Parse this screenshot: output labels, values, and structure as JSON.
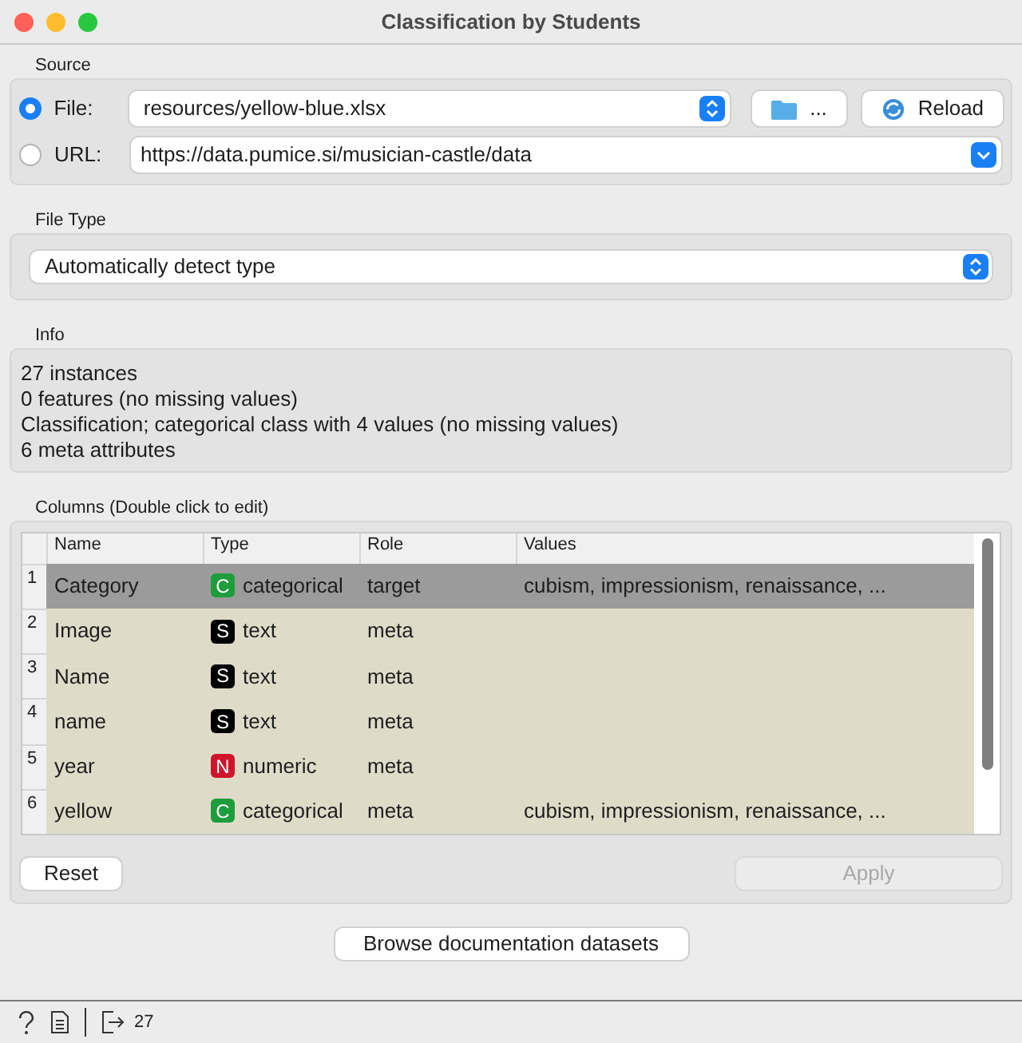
{
  "window": {
    "title": "Classification by Students"
  },
  "source": {
    "label": "Source",
    "options": [
      {
        "label": "File:",
        "selected": true,
        "value": "resources/yellow-blue.xlsx",
        "kind": "file"
      },
      {
        "label": "URL:",
        "selected": false,
        "value": "https://data.pumice.si/musician-castle/data",
        "kind": "url"
      }
    ],
    "browse_button": "...",
    "reload_button": "Reload"
  },
  "file_type": {
    "label": "File Type",
    "value": "Automatically detect type"
  },
  "info": {
    "label": "Info",
    "lines": [
      "27 instances",
      "0 features (no missing values)",
      "Classification; categorical class with 4 values (no missing values)",
      "6 meta attributes"
    ]
  },
  "columns": {
    "label": "Columns (Double click to edit)",
    "table": {
      "columns": [
        "Name",
        "Type",
        "Role",
        "Values"
      ],
      "rows": [
        {
          "index": "1",
          "name": "Category",
          "badge": "C",
          "kind": "categorical",
          "type": "categorical",
          "role": "target",
          "values": "cubism, impressionism, renaissance, ...",
          "selected": true
        },
        {
          "index": "2",
          "name": "Image",
          "badge": "S",
          "kind": "text",
          "type": "text",
          "role": "meta",
          "selected": false
        },
        {
          "index": "3",
          "name": "Name",
          "badge": "S",
          "kind": "text",
          "type": "text",
          "role": "meta",
          "selected": false
        },
        {
          "index": "4",
          "name": "name",
          "badge": "S",
          "kind": "text",
          "type": "text",
          "role": "meta",
          "selected": false
        },
        {
          "index": "5",
          "name": "year",
          "badge": "N",
          "kind": "numeric",
          "type": "numeric",
          "role": "meta",
          "selected": false
        },
        {
          "index": "6",
          "name": "yellow",
          "badge": "C",
          "kind": "categorical",
          "type": "categorical",
          "role": "meta",
          "values": "cubism, impressionism, renaissance, ...",
          "selected": false
        }
      ]
    },
    "reset_button": "Reset",
    "apply_button": {
      "label": "Apply",
      "disabled": true
    }
  },
  "browse_docs_button": "Browse documentation datasets",
  "status_bar": {
    "output_count": "27"
  }
}
